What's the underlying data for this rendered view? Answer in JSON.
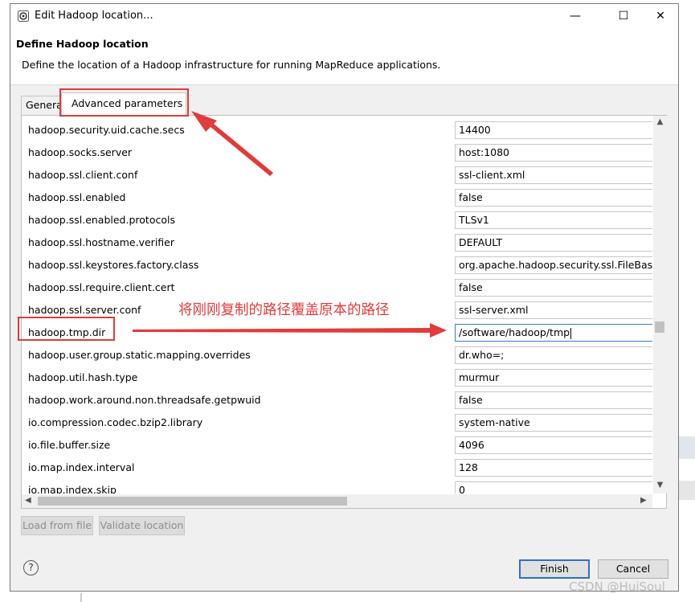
{
  "window": {
    "title": "Edit Hadoop location...",
    "minimize_glyph": "—",
    "maximize_glyph": "☐",
    "close_glyph": "✕"
  },
  "header": {
    "title": "Define Hadoop location",
    "description": "Define the location of a Hadoop infrastructure for running MapReduce applications."
  },
  "tabs": [
    {
      "label": "General"
    },
    {
      "label": "Advanced parameters"
    }
  ],
  "table": {
    "rows": [
      {
        "key": "hadoop.security.uid.cache.secs",
        "value": "14400"
      },
      {
        "key": "hadoop.socks.server",
        "value": "host:1080"
      },
      {
        "key": "hadoop.ssl.client.conf",
        "value": "ssl-client.xml"
      },
      {
        "key": "hadoop.ssl.enabled",
        "value": "false"
      },
      {
        "key": "hadoop.ssl.enabled.protocols",
        "value": "TLSv1"
      },
      {
        "key": "hadoop.ssl.hostname.verifier",
        "value": "DEFAULT"
      },
      {
        "key": "hadoop.ssl.keystores.factory.class",
        "value": "org.apache.hadoop.security.ssl.FileBasedK"
      },
      {
        "key": "hadoop.ssl.require.client.cert",
        "value": "false"
      },
      {
        "key": "hadoop.ssl.server.conf",
        "value": "ssl-server.xml"
      },
      {
        "key": "hadoop.tmp.dir",
        "value": "/software/hadoop/tmp"
      },
      {
        "key": "hadoop.user.group.static.mapping.overrides",
        "value": "dr.who=;"
      },
      {
        "key": "hadoop.util.hash.type",
        "value": "murmur"
      },
      {
        "key": "hadoop.work.around.non.threadsafe.getpwuid",
        "value": "false"
      },
      {
        "key": "io.compression.codec.bzip2.library",
        "value": "system-native"
      },
      {
        "key": "io.file.buffer.size",
        "value": "4096"
      },
      {
        "key": "io.map.index.interval",
        "value": "128"
      },
      {
        "key": "io.map.index.skip",
        "value": "0"
      }
    ]
  },
  "scroll_glyphs": {
    "up": "▲",
    "down": "▼",
    "left": "◀",
    "right": "▶"
  },
  "buttons": {
    "load_from_file": "Load from file",
    "validate_location": "Validate location",
    "finish": "Finish",
    "cancel": "Cancel",
    "help": "?"
  },
  "annotation": {
    "text": "将刚刚复制的路径覆盖原本的路径",
    "color": "#e23b3b"
  },
  "watermark": "CSDN @HuiSoul",
  "colors": {
    "dialog_bg": "#f0f0f0",
    "focus_border": "#3a7bd5",
    "annotation_red": "#e23b3b"
  }
}
